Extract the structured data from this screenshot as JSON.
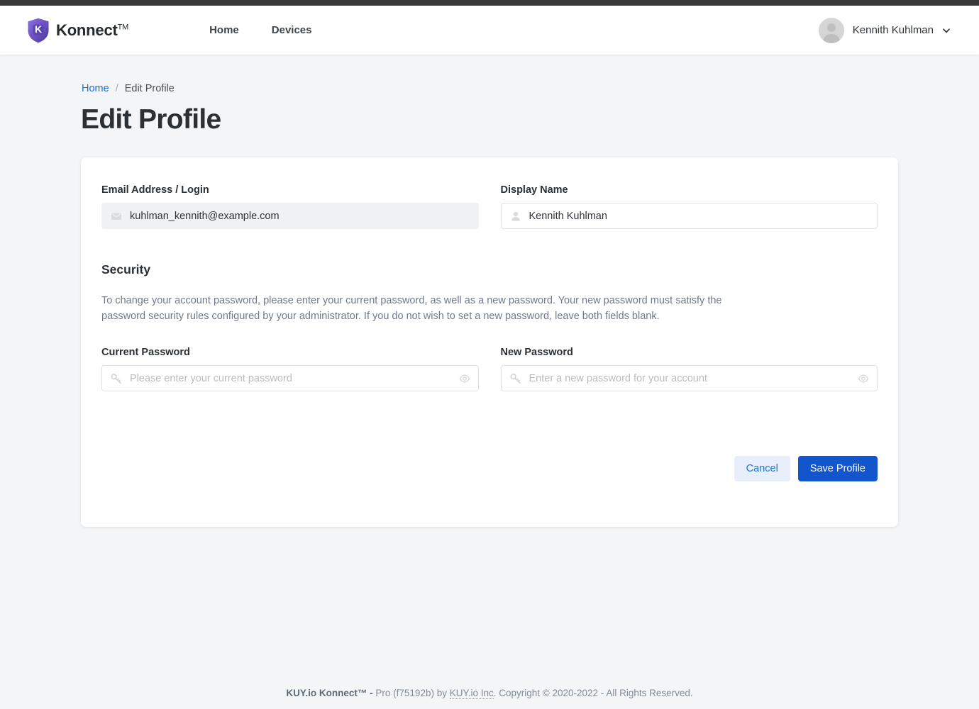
{
  "header": {
    "brand_name": "Konnect",
    "brand_tm": "TM",
    "nav": [
      {
        "label": "Home"
      },
      {
        "label": "Devices"
      }
    ],
    "user_name": "Kennith Kuhlman"
  },
  "breadcrumb": {
    "home_label": "Home",
    "separator": "/",
    "current_label": "Edit Profile"
  },
  "page": {
    "title": "Edit Profile"
  },
  "form": {
    "email": {
      "label": "Email Address / Login",
      "value": "kuhlman_kennith@example.com",
      "icon": "envelope-icon",
      "disabled": true
    },
    "display_name": {
      "label": "Display Name",
      "value": "Kennith Kuhlman",
      "icon": "user-icon"
    },
    "security": {
      "title": "Security",
      "description": "To change your account password, please enter your current password, as well as a new password. Your new password must satisfy the password security rules configured by your administrator. If you do not wish to set a new password, leave both fields blank."
    },
    "current_password": {
      "label": "Current Password",
      "placeholder": "Please enter your current password",
      "value": "",
      "icon": "key-icon",
      "toggle_icon": "eye-icon"
    },
    "new_password": {
      "label": "New Password",
      "placeholder": "Enter a new password for your account",
      "value": "",
      "icon": "key-icon",
      "toggle_icon": "eye-icon"
    },
    "actions": {
      "cancel_label": "Cancel",
      "save_label": "Save Profile"
    }
  },
  "footer": {
    "brand": "KUY.io Konnect™ -",
    "mid": "Pro (f75192b) by",
    "company": "KUY.io Inc",
    "tail": ". Copyright © 2020-2022 - All Rights Reserved."
  },
  "colors": {
    "accent": "#1355cc",
    "link": "#1a6fd4",
    "cancel_bg": "#e8effb",
    "brand_purple": "#6b4fc4",
    "topbar": "#383838"
  }
}
